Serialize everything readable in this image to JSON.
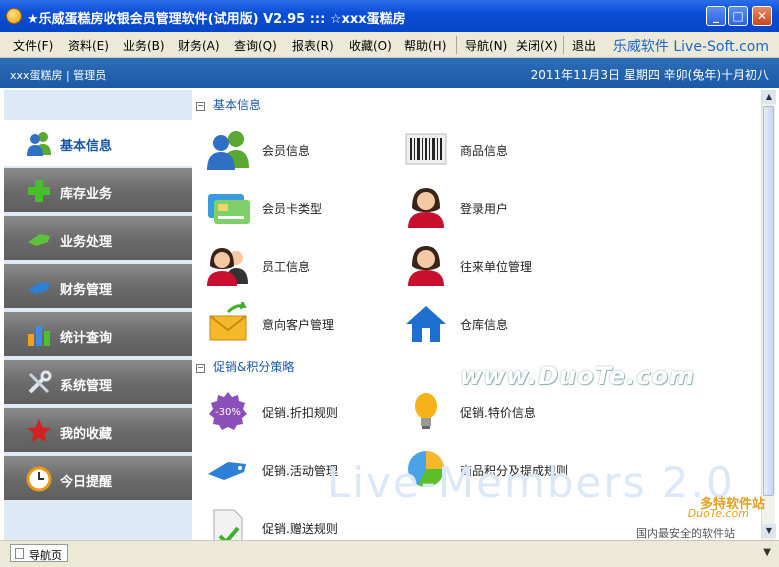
{
  "window": {
    "title": "★乐威蛋糕房收银会员管理软件(试用版)  V2.95   :::  ☆xxx蛋糕房",
    "minimize": "_",
    "maximize": "□",
    "close": "✕"
  },
  "menu": {
    "items": [
      "文件(F)",
      "资料(E)",
      "业务(B)",
      "财务(A)",
      "查询(Q)",
      "报表(R)",
      "收藏(O)",
      "帮助(H)",
      "导航(N)",
      "关闭(X)",
      "退出"
    ],
    "brand": "乐威软件 Live-Soft.com"
  },
  "infobar": {
    "shop": "xxx蛋糕房 | 管理员",
    "datetime": "2011年11月3日  星期四  辛卯(兔年)十月初八"
  },
  "sidebar": {
    "items": [
      {
        "label": "基本信息",
        "icon": "users-icon"
      },
      {
        "label": "库存业务",
        "icon": "plus-icon"
      },
      {
        "label": "业务处理",
        "icon": "tag-icon"
      },
      {
        "label": "财务管理",
        "icon": "card-icon"
      },
      {
        "label": "统计查询",
        "icon": "bar-chart-icon"
      },
      {
        "label": "系统管理",
        "icon": "tools-icon"
      },
      {
        "label": "我的收藏",
        "icon": "star-icon"
      },
      {
        "label": "今日提醒",
        "icon": "clock-icon"
      }
    ]
  },
  "sections": {
    "basic": {
      "title": "基本信息",
      "toggle": "−",
      "tiles": [
        {
          "label": "会员信息",
          "icon": "users-icon"
        },
        {
          "label": "商品信息",
          "icon": "barcode-icon"
        },
        {
          "label": "会员卡类型",
          "icon": "member-card-icon"
        },
        {
          "label": "登录用户",
          "icon": "user-female-icon"
        },
        {
          "label": "员工信息",
          "icon": "staff-icon"
        },
        {
          "label": "往来单位管理",
          "icon": "user-female-icon"
        },
        {
          "label": "意向客户管理",
          "icon": "mail-icon"
        },
        {
          "label": "仓库信息",
          "icon": "house-icon"
        }
      ]
    },
    "promo": {
      "title": "促销&积分策略",
      "toggle": "−",
      "tiles": [
        {
          "label": "促销.折扣规则",
          "icon": "discount-badge-icon",
          "badge": "-30%"
        },
        {
          "label": "促销.特价信息",
          "icon": "lightbulb-icon"
        },
        {
          "label": "促销.活动管理",
          "icon": "tag-icon"
        },
        {
          "label": "商品积分及提成规则",
          "icon": "pie-chart-icon"
        },
        {
          "label": "促销.赠送规则",
          "icon": "document-check-icon"
        }
      ]
    }
  },
  "watermarks": {
    "duote_center": "www.DuoTe.com",
    "live_members": "Live-Members 2.0",
    "duote_logo": "多特软件站",
    "duote_url": "DuoTe.com",
    "duote_slogan": "国内最安全的软件站"
  },
  "statusbar": {
    "tab_label": "导航页"
  },
  "colors": {
    "titlebar": "#0a4fd6",
    "infobar": "#1b5aa6",
    "accent": "#1a56a8",
    "sidebar_bg": "#dce9f7"
  }
}
